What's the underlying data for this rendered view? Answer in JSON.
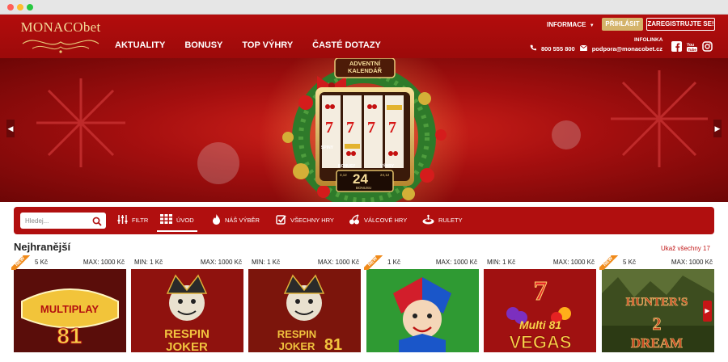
{
  "browser": {
    "dots": [
      "#ff5f57",
      "#febc2e",
      "#28c840"
    ]
  },
  "header": {
    "logo_text": "MONACObet",
    "nav": [
      "AKTUALITY",
      "BONUSY",
      "TOP VÝHRY",
      "ČASTÉ DOTAZY"
    ],
    "info_label": "INFORMACE",
    "login_label": "PŘIHLÁSIT",
    "register_label": "ZAREGISTRUJTE SE!",
    "infolinka_label": "INFOLINKA",
    "phone": "800 555 800",
    "email": "podpora@monacobet.cz",
    "social_icons": [
      "facebook-icon",
      "youtube-icon",
      "instagram-icon"
    ]
  },
  "banner": {
    "title_line1": "ADVENTNÍ",
    "title_line2": "KALENDÁŘ",
    "spiny_label": "SPINY",
    "bonusy_label": "BONUSY",
    "vyhry_label": "VÝHRY",
    "day_number": "24",
    "bonus_small": "BONUSU",
    "left_small": "3,12",
    "right_small": "24,12"
  },
  "filterbar": {
    "search_placeholder": "Hledej...",
    "items": [
      "FILTR",
      "ÚVOD",
      "NÁŠ VÝBĚR",
      "VŠECHNY HRY",
      "VÁLCOVÉ HRY",
      "RULETY"
    ],
    "active": "ÚVOD"
  },
  "section": {
    "title": "Nejhranější",
    "show_all": "Ukaž všechny 17"
  },
  "games": [
    {
      "min": "5 Kč",
      "max": "MAX: 1000 Kč",
      "new": true,
      "art": [
        "MULTIPLAY",
        "81"
      ],
      "bg": "#7d1410"
    },
    {
      "min": "MIN: 1 Kč",
      "max": "MAX: 1000 Kč",
      "new": false,
      "art": [
        "RESPIN",
        "JOKER"
      ],
      "bg": "#a3140f"
    },
    {
      "min": "MIN: 1 Kč",
      "max": "MAX: 1000 Kč",
      "new": false,
      "art": [
        "RESPIN",
        "JOKER 81"
      ],
      "bg": "#9a1a10"
    },
    {
      "min": "1 Kč",
      "max": "MAX: 1000 Kč",
      "new": true,
      "art": [
        "",
        ""
      ],
      "bg": "#3aa62d"
    },
    {
      "min": "MIN: 1 Kč",
      "max": "MAX: 1000 Kč",
      "new": false,
      "art": [
        "Multi 81",
        "VEGAS"
      ],
      "bg": "#a81313"
    },
    {
      "min": "5 Kč",
      "max": "MAX: 1000 Kč",
      "new": true,
      "art": [
        "HUNTER'S",
        "DREAM 2"
      ],
      "bg": "#465a22"
    }
  ],
  "new_label": "NEW"
}
